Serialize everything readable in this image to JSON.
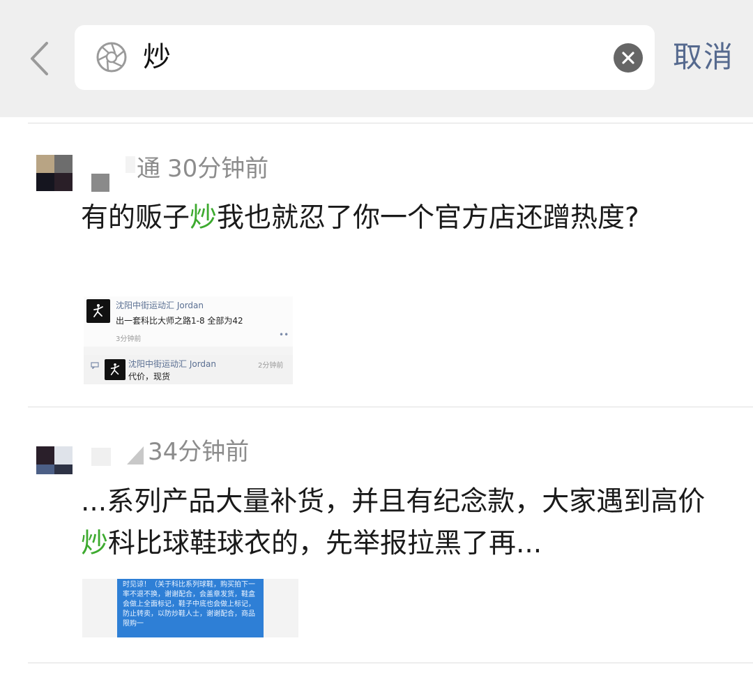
{
  "search": {
    "query": "炒",
    "cancel_label": "取消"
  },
  "posts": [
    {
      "author": "通",
      "time": "30分钟前",
      "body_before": "有的贩子",
      "keyword": "炒",
      "body_after": "我也就忍了你一个官方店还蹭热度?",
      "quoted": [
        {
          "name": "沈阳中街运动汇 Jordan",
          "text": "出一套科比大师之路1-8 全部为42",
          "time": "3分钟前"
        },
        {
          "name": "沈阳中街运动汇 Jordan",
          "text": "代价，现货",
          "time": "2分钟前"
        }
      ]
    },
    {
      "author": "",
      "time": "34分钟前",
      "body_before": "...系列产品大量补货，并且有纪念款，大家遇到高价",
      "keyword": "炒",
      "body_after": "科比球鞋球衣的，先举报拉黑了再...",
      "image_text": "时见谅！（关于科比系列球鞋，购买拍下一率不退不换，谢谢配合，会盖章发货，鞋盒会做上全面标记，鞋子中底也会做上标记，防止转卖，以防炒鞋人士，谢谢配合，商品限购一"
    }
  ],
  "colors": {
    "header_bg": "#efefef",
    "highlight": "#3daa2f",
    "cancel": "#55698e",
    "meta": "#8c8c8c"
  },
  "icons": {
    "back": "chevron-left-icon",
    "search": "aperture-icon",
    "clear": "clear-x-icon",
    "brand": "jordan-jumpman-icon"
  }
}
